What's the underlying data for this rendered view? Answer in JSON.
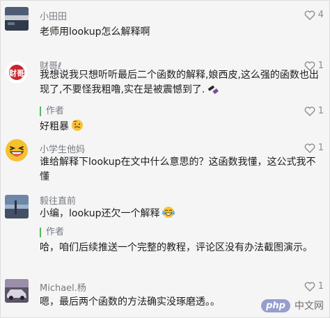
{
  "comments": [
    {
      "user": "小田田",
      "likes": "4",
      "text": "老师用lookup怎么解释啊",
      "avatar_icon": "landscape-avatar"
    },
    {
      "user": "财哥ℓ",
      "likes": "1",
      "text": "我想说我只想听听最后二个函数的解释,娘西皮,这么强的函数也出现了,不要怪我粗噜,实在是被震憾到了.",
      "trailing_icon": "mop-emoji-icon",
      "avatar_icon": "red-seal-avatar",
      "avatar_text": "财哥",
      "reply": {
        "label": "作者",
        "likes": "1",
        "text": "好粗暴",
        "trailing_icon": "awkward-emoji-icon"
      }
    },
    {
      "user": "小学生他妈",
      "likes": "1",
      "text": "谁给解释下lookup在文中什么意思的？这函数我懂，这公式我不懂",
      "avatar_icon": "grin-emoji-avatar"
    },
    {
      "user": "毅往直前",
      "likes": "",
      "text": "小编，lookup还欠一个解释",
      "trailing_icon": "tears-of-joy-emoji-icon",
      "avatar_icon": "sky-avatar",
      "reply": {
        "label": "作者",
        "likes": "",
        "text": "哈，咱们后续推送一个完整的教程，评论区没有办法截图演示。"
      }
    },
    {
      "user": "Michael.杨",
      "likes": "1",
      "text": "嗯，最后两个函数的方法确实没琢磨透。。",
      "avatar_icon": "car-avatar"
    }
  ],
  "watermark": {
    "php": "php",
    "cn": "中文网"
  },
  "colors": {
    "background": "#f5f5f5",
    "username": "#767a82",
    "author_bar": "#53b85b"
  }
}
